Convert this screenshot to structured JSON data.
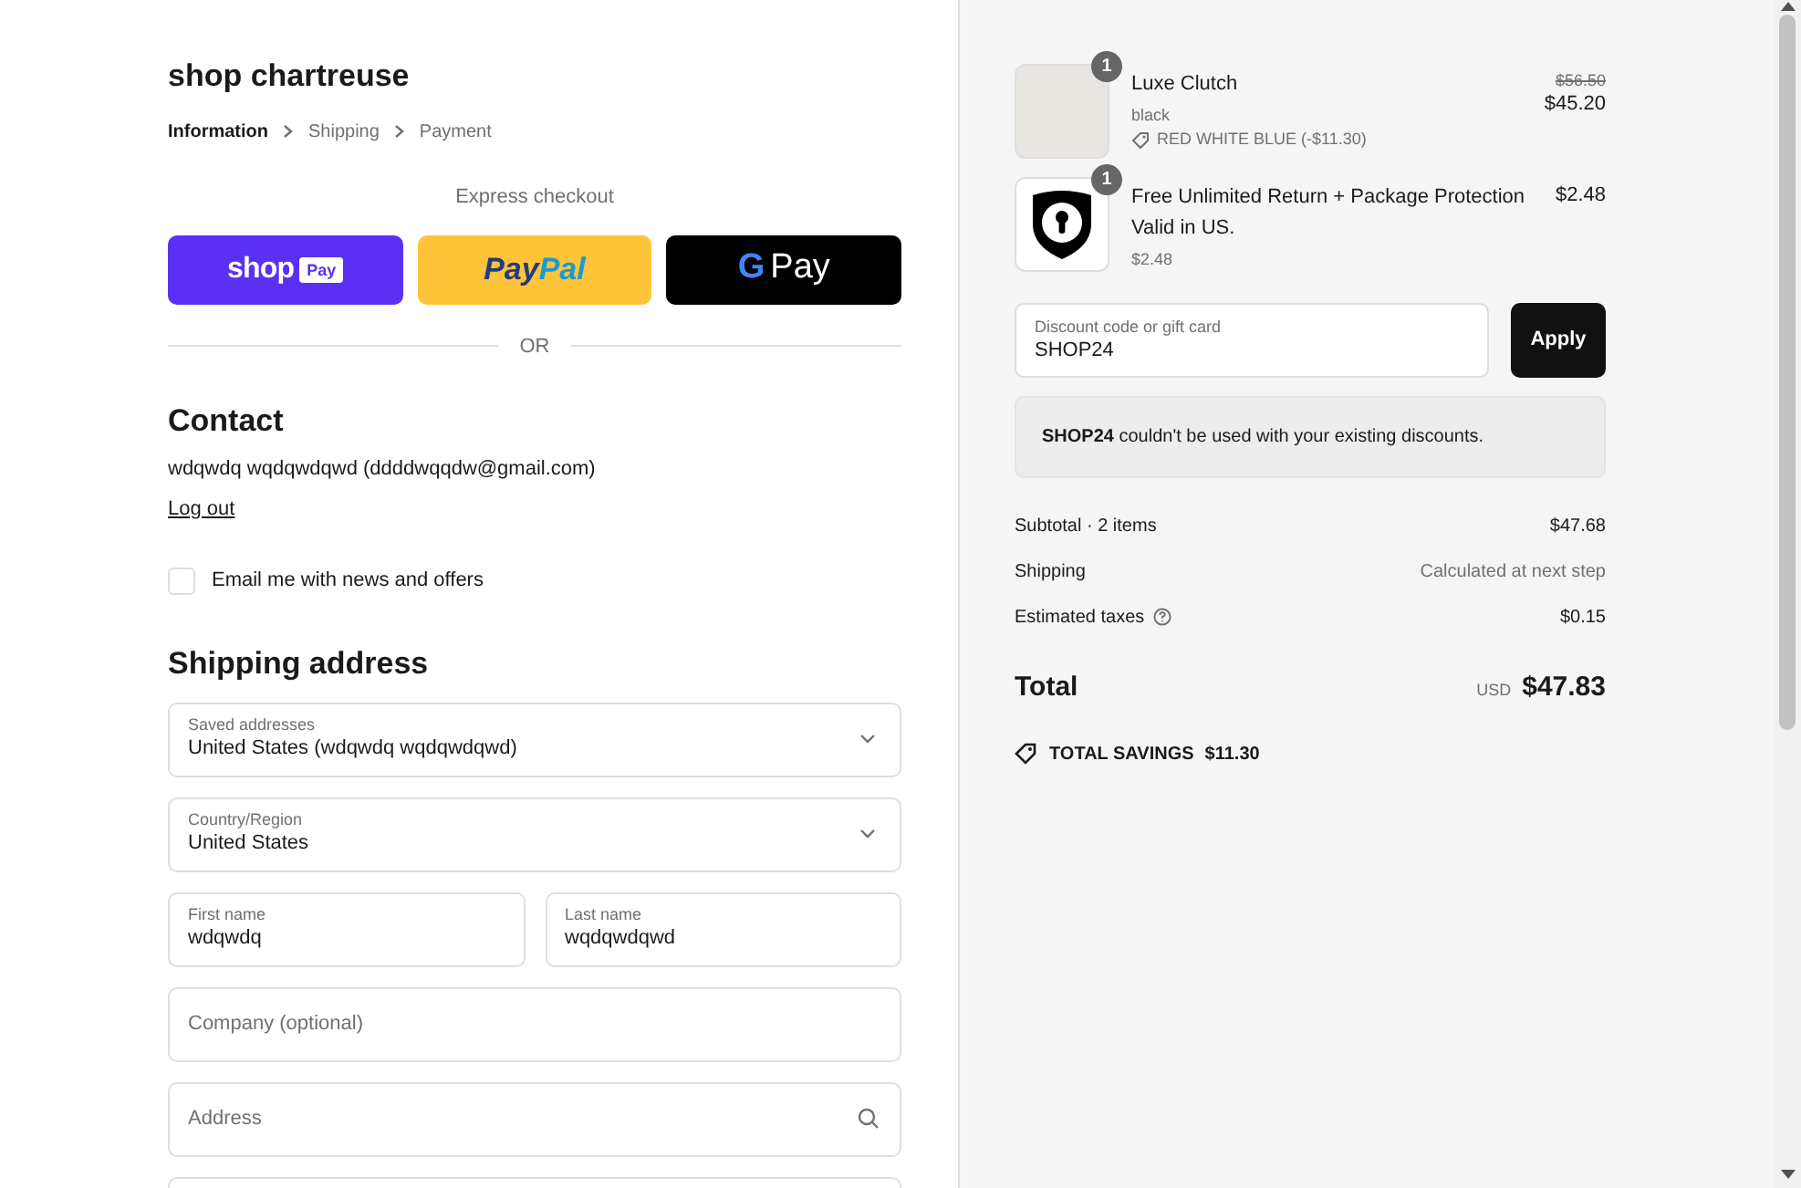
{
  "store": {
    "title": "shop chartreuse"
  },
  "breadcrumbs": [
    {
      "label": "Information",
      "selected": true
    },
    {
      "label": "Shipping",
      "selected": false
    },
    {
      "label": "Payment",
      "selected": false
    }
  ],
  "express_checkout": {
    "title": "Express checkout",
    "divider": "OR",
    "buttons": [
      {
        "kind": "shop",
        "label": "shop",
        "badge": "Pay"
      },
      {
        "kind": "paypal",
        "label": "Pay",
        "label_2": "Pal"
      },
      {
        "kind": "gpay",
        "label": "G",
        "label_2": "Pay"
      }
    ]
  },
  "contact": {
    "heading": "Contact",
    "account": "wdqwdq wqdqwdqwd (ddddwqqdw@gmail.com)",
    "logout": "Log out",
    "newsletter": {
      "label": "Email me with news and offers",
      "checked": false
    }
  },
  "shipping_address": {
    "heading": "Shipping address",
    "fields": [
      {
        "kind": "select",
        "label": "Saved addresses",
        "value": "United States (wdqwdq wqdqwdqwd)"
      },
      {
        "kind": "select",
        "label": "Country/Region",
        "value": "United States"
      },
      {
        "kind": "pair",
        "items": [
          {
            "label": "First name",
            "value": "wdqwdq"
          },
          {
            "label": "Last name",
            "value": "wqdqwdqwd"
          }
        ]
      },
      {
        "kind": "text",
        "placeholder": "Company (optional)"
      },
      {
        "kind": "search",
        "placeholder": "Address"
      },
      {
        "kind": "blank"
      }
    ]
  },
  "order_summary": {
    "items": [
      {
        "kind": "photo",
        "quantity": "1",
        "name": "Luxe Clutch",
        "variant": "black",
        "discount": "RED WHITE BLUE (-$11.30)",
        "original_price": "$56.50",
        "price": "$45.20"
      },
      {
        "kind": "shield",
        "quantity": "1",
        "name": "Free Unlimited Return + Package Protection Valid in US.",
        "variant": "$2.48",
        "price": "$2.48"
      }
    ],
    "discount_field": {
      "label": "Discount code or gift card",
      "value": "SHOP24"
    },
    "apply_button": "Apply",
    "notice": {
      "code": "SHOP24",
      "message": "couldn't be used with your existing discounts."
    },
    "lines": [
      {
        "kind": "plain",
        "label": "Subtotal · 2 items",
        "value": "$47.68"
      },
      {
        "kind": "muted",
        "label": "Shipping",
        "value": "Calculated at next step"
      },
      {
        "kind": "help",
        "label": "Estimated taxes",
        "value": "$0.15"
      }
    ],
    "total": {
      "label": "Total",
      "currency": "USD",
      "value": "$47.83"
    },
    "savings": {
      "label": "TOTAL SAVINGS",
      "value": "$11.30"
    }
  }
}
